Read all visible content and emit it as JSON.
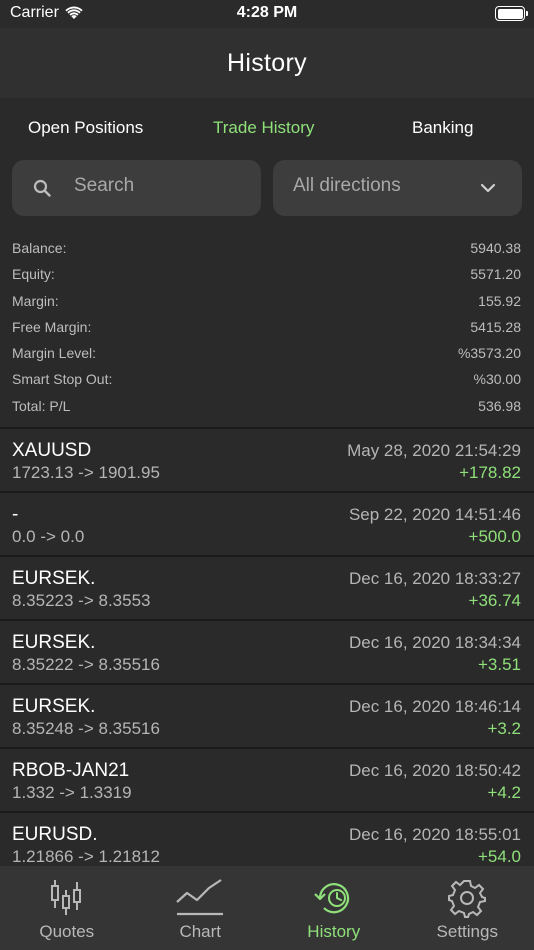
{
  "status_bar": {
    "carrier": "Carrier",
    "time": "4:28 PM"
  },
  "nav": {
    "title": "History"
  },
  "tabs": [
    {
      "label": "Open Positions",
      "active": false
    },
    {
      "label": "Trade History",
      "active": true
    },
    {
      "label": "Banking",
      "active": false
    }
  ],
  "search": {
    "placeholder": "Search"
  },
  "direction": {
    "selected": "All directions"
  },
  "summary": [
    {
      "label": "Balance:",
      "value": "5940.38"
    },
    {
      "label": "Equity:",
      "value": "5571.20"
    },
    {
      "label": "Margin:",
      "value": "155.92"
    },
    {
      "label": "Free Margin:",
      "value": "5415.28"
    },
    {
      "label": "Margin Level:",
      "value": "%3573.20"
    },
    {
      "label": "Smart Stop Out:",
      "value": "%30.00"
    },
    {
      "label": "Total: P/L",
      "value": "536.98"
    }
  ],
  "trades": [
    {
      "symbol": "XAUUSD",
      "prices": "1723.13 -> 1901.95",
      "date": "May 28, 2020 21:54:29",
      "pl": "+178.82"
    },
    {
      "symbol": "-",
      "prices": "0.0 -> 0.0",
      "date": "Sep 22, 2020 14:51:46",
      "pl": "+500.0"
    },
    {
      "symbol": "EURSEK.",
      "prices": "8.35223 -> 8.3553",
      "date": "Dec 16, 2020 18:33:27",
      "pl": "+36.74"
    },
    {
      "symbol": "EURSEK.",
      "prices": "8.35222 -> 8.35516",
      "date": "Dec 16, 2020 18:34:34",
      "pl": "+3.51"
    },
    {
      "symbol": "EURSEK.",
      "prices": "8.35248 -> 8.35516",
      "date": "Dec 16, 2020 18:46:14",
      "pl": "+3.2"
    },
    {
      "symbol": "RBOB-JAN21",
      "prices": "1.332 -> 1.3319",
      "date": "Dec 16, 2020 18:50:42",
      "pl": "+4.2"
    },
    {
      "symbol": "EURUSD.",
      "prices": "1.21866 -> 1.21812",
      "date": "Dec 16, 2020 18:55:01",
      "pl": "+54.0"
    }
  ],
  "tab_bar": [
    {
      "label": "Quotes",
      "icon": "candlestick-icon",
      "active": false
    },
    {
      "label": "Chart",
      "icon": "line-chart-icon",
      "active": false
    },
    {
      "label": "History",
      "icon": "history-clock-icon",
      "active": true
    },
    {
      "label": "Settings",
      "icon": "gear-icon",
      "active": false
    }
  ],
  "colors": {
    "accent": "#8fe07a",
    "background": "#2a2a2a",
    "field": "#3d3d3d",
    "separator": "#1a1a1a"
  }
}
